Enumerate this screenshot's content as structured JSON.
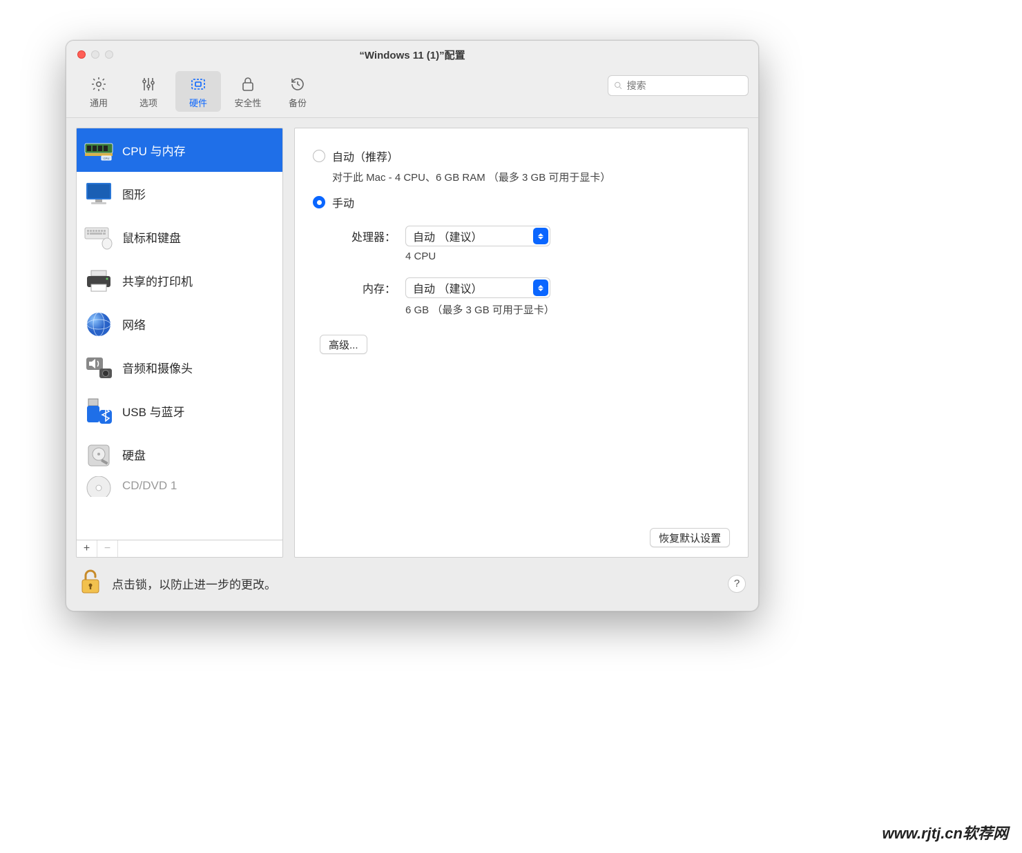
{
  "window": {
    "title": "“Windows 11 (1)”配置"
  },
  "toolbar": {
    "items": [
      {
        "label": "通用"
      },
      {
        "label": "选项"
      },
      {
        "label": "硬件"
      },
      {
        "label": "安全性"
      },
      {
        "label": "备份"
      }
    ],
    "search_placeholder": "搜索"
  },
  "sidebar": {
    "items": [
      {
        "label": "CPU 与内存"
      },
      {
        "label": "图形"
      },
      {
        "label": "鼠标和键盘"
      },
      {
        "label": "共享的打印机"
      },
      {
        "label": "网络"
      },
      {
        "label": "音频和摄像头"
      },
      {
        "label": "USB 与蓝牙"
      },
      {
        "label": "硬盘"
      },
      {
        "label": "CD/DVD 1"
      }
    ]
  },
  "content": {
    "auto_label": "自动（推荐）",
    "auto_desc": "对于此 Mac - 4 CPU、6 GB RAM （最多 3 GB 可用于显卡）",
    "manual_label": "手动",
    "cpu_label": "处理器：",
    "cpu_select": "自动 （建议）",
    "cpu_sub": "4 CPU",
    "mem_label": "内存：",
    "mem_select": "自动 （建议）",
    "mem_sub": "6 GB （最多 3 GB 可用于显卡）",
    "advanced_label": "高级...",
    "restore_label": "恢复默认设置"
  },
  "footer": {
    "lock_label": "点击锁，以防止进一步的更改。",
    "help": "?"
  },
  "watermark": "www.rjtj.cn软荐网"
}
